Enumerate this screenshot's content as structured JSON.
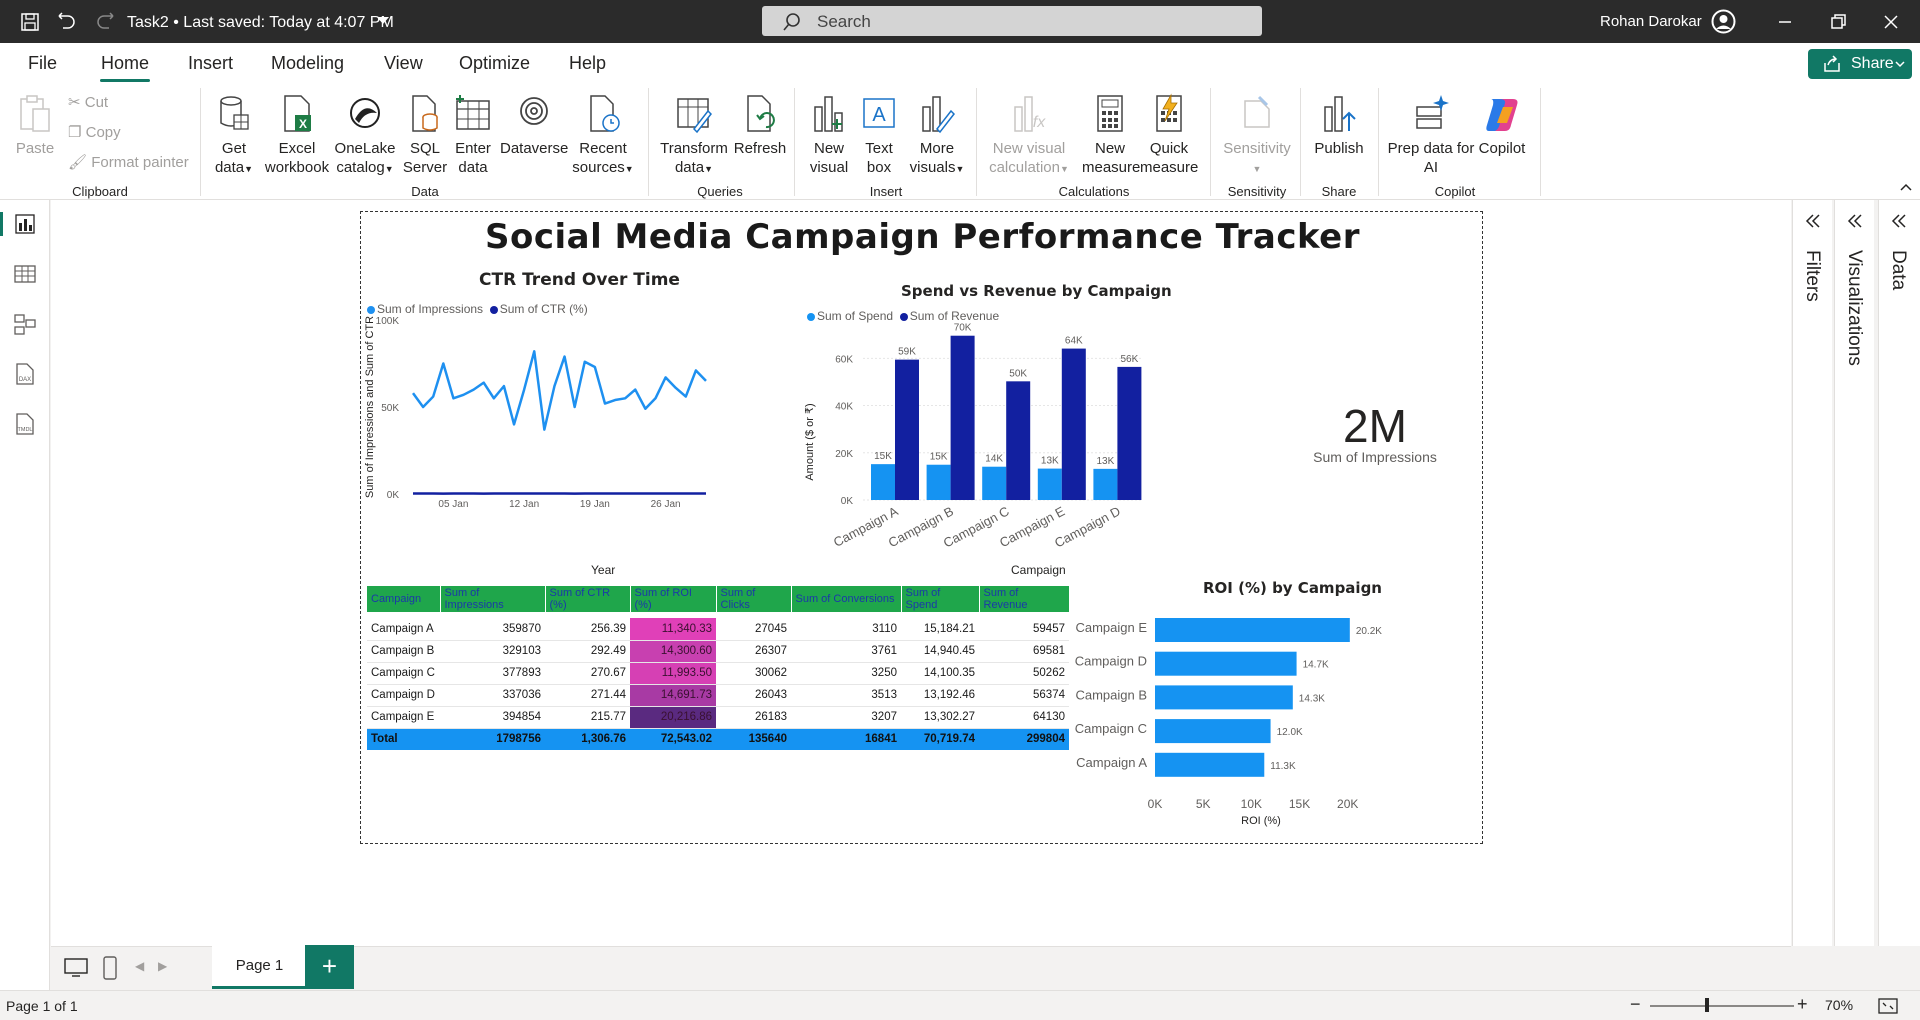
{
  "titlebar": {
    "doc_title": "Task2 • Last saved: Today at 4:07 PM",
    "search_placeholder": "Search",
    "user_name": "Rohan Darokar"
  },
  "menu": {
    "items": [
      "File",
      "Home",
      "Insert",
      "Modeling",
      "View",
      "Optimize",
      "Help"
    ],
    "active": "Home",
    "share_label": "Share"
  },
  "ribbon": {
    "clipboard": {
      "paste": "Paste",
      "cut": "Cut",
      "copy": "Copy",
      "format_painter": "Format painter",
      "group": "Clipboard"
    },
    "data": {
      "get_data": [
        "Get",
        "data"
      ],
      "excel": [
        "Excel",
        "workbook"
      ],
      "onelake": [
        "OneLake",
        "catalog"
      ],
      "sql": [
        "SQL",
        "Server"
      ],
      "enter": [
        "Enter",
        "data"
      ],
      "dataverse": [
        "Dataverse"
      ],
      "recent": [
        "Recent",
        "sources"
      ],
      "group": "Data"
    },
    "queries": {
      "transform": [
        "Transform",
        "data"
      ],
      "refresh": [
        "Refresh"
      ],
      "group": "Queries"
    },
    "insert": {
      "new_visual": [
        "New",
        "visual"
      ],
      "text_box": [
        "Text",
        "box"
      ],
      "more_visuals": [
        "More",
        "visuals"
      ],
      "group": "Insert"
    },
    "calculations": {
      "new_visual_calc": [
        "New visual",
        "calculation"
      ],
      "new_measure": [
        "New",
        "measure"
      ],
      "quick_measure": [
        "Quick",
        "measure"
      ],
      "group": "Calculations"
    },
    "sensitivity": {
      "label": "Sensitivity",
      "group": "Sensitivity"
    },
    "share": {
      "publish": "Publish",
      "group": "Share"
    },
    "copilot": {
      "prep": [
        "Prep data for",
        "AI"
      ],
      "copilot": "Copilot",
      "group": "Copilot"
    }
  },
  "side_panes": {
    "filters": "Filters",
    "visualizations": "Visualizations",
    "data": "Data"
  },
  "pages": {
    "tab": "Page 1",
    "add": "+",
    "status": "Page 1 of 1",
    "zoom": "70%"
  },
  "report": {
    "title": "Social Media Campaign Performance Tracker",
    "kpi": {
      "value": "2M",
      "label": "Sum of Impressions"
    },
    "colors": {
      "light_blue": "#1593f2",
      "dark_blue": "#1220a0",
      "line_blue": "#1e90f0",
      "header_green": "#1fa64b"
    }
  },
  "chart_data": [
    {
      "type": "line",
      "title": "CTR Trend Over Time",
      "xlabel": "Year",
      "ylabel": "Sum of Impressions and Sum of CTR",
      "legend": [
        "Sum of Impressions",
        "Sum of CTR (%)"
      ],
      "x_ticks": [
        "05 Jan",
        "12 Jan",
        "19 Jan",
        "26 Jan"
      ],
      "y_ticks": [
        "100K",
        "50K",
        "0K"
      ],
      "ylim": [
        0,
        100000
      ],
      "series": [
        {
          "name": "Sum of Impressions",
          "values": [
            58000,
            50000,
            56000,
            75000,
            55000,
            57000,
            60000,
            64000,
            55000,
            62000,
            40000,
            60000,
            82000,
            37000,
            62000,
            79000,
            50000,
            76000,
            73000,
            52000,
            54000,
            55000,
            60000,
            49000,
            55000,
            67000,
            61000,
            56000,
            71000,
            65000
          ]
        },
        {
          "name": "Sum of CTR (%)",
          "values": [
            257,
            280,
            310,
            240,
            265,
            290,
            300,
            250,
            275,
            260,
            285,
            270,
            255,
            295,
            262,
            278,
            248,
            268,
            300,
            258,
            282,
            266,
            274,
            252,
            290,
            263,
            271,
            279,
            256,
            284
          ]
        }
      ]
    },
    {
      "type": "bar",
      "title": "Spend vs Revenue by Campaign",
      "xlabel": "Campaign",
      "ylabel": "Amount ($ or ₹)",
      "legend": [
        "Sum of Spend",
        "Sum of Revenue"
      ],
      "categories": [
        "Campaign A",
        "Campaign B",
        "Campaign C",
        "Campaign E",
        "Campaign D"
      ],
      "y_ticks": [
        "60K",
        "40K",
        "20K",
        "0K"
      ],
      "ylim": [
        0,
        72000
      ],
      "series": [
        {
          "name": "Sum of Spend",
          "values": [
            15184,
            14940,
            14100,
            13302,
            13192
          ],
          "labels": [
            "15K",
            "15K",
            "14K",
            "13K",
            "13K"
          ]
        },
        {
          "name": "Sum of Revenue",
          "values": [
            59457,
            69581,
            50262,
            64130,
            56374
          ],
          "labels": [
            "59K",
            "70K",
            "50K",
            "64K",
            "56K"
          ]
        }
      ]
    },
    {
      "type": "bar",
      "orientation": "horizontal",
      "title": "ROI (%) by Campaign",
      "xlabel": "ROI (%)",
      "categories": [
        "Campaign E",
        "Campaign D",
        "Campaign B",
        "Campaign C",
        "Campaign A"
      ],
      "values": [
        20216.86,
        14691.73,
        14300.6,
        11993.5,
        11340.33
      ],
      "labels": [
        "20.2K",
        "14.7K",
        "14.3K",
        "12.0K",
        "11.3K"
      ],
      "x_ticks": [
        "0K",
        "5K",
        "10K",
        "15K",
        "20K"
      ],
      "xlim": [
        0,
        22000
      ]
    },
    {
      "type": "table",
      "columns": [
        "Campaign",
        "Sum of Impressions",
        "Sum of CTR (%)",
        "Sum of ROI (%)",
        "Sum of Clicks",
        "Sum of Conversions",
        "Sum of Spend",
        "Sum of Revenue"
      ],
      "rows": [
        [
          "Campaign A",
          "359870",
          "256.39",
          "11,340.33",
          "27045",
          "3110",
          "15,184.21",
          "59457"
        ],
        [
          "Campaign B",
          "329103",
          "292.49",
          "14,300.60",
          "26307",
          "3761",
          "14,940.45",
          "69581"
        ],
        [
          "Campaign C",
          "377893",
          "270.67",
          "11,993.50",
          "30062",
          "3250",
          "14,100.35",
          "50262"
        ],
        [
          "Campaign D",
          "337036",
          "271.44",
          "14,691.73",
          "26043",
          "3513",
          "13,192.46",
          "56374"
        ],
        [
          "Campaign E",
          "394854",
          "215.77",
          "20,216.86",
          "26183",
          "3207",
          "13,302.27",
          "64130"
        ]
      ],
      "roi_colors": [
        "#e040b8",
        "#c840b0",
        "#d640b4",
        "#a83aa4",
        "#5a2a80"
      ],
      "total": [
        "Total",
        "1798756",
        "1,306.76",
        "72,543.02",
        "135640",
        "16841",
        "70,719.74",
        "299804"
      ]
    }
  ]
}
